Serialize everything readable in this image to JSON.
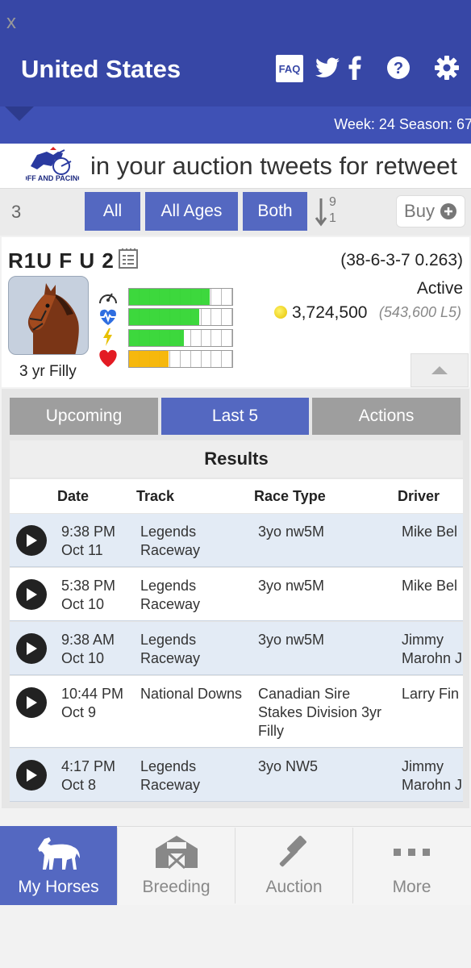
{
  "header": {
    "title": "United States",
    "faq_label": "FAQ",
    "week_season": "Week: 24  Season: 67"
  },
  "ticker": {
    "close": "x",
    "text": "in your auction tweets for retweet"
  },
  "filters": {
    "count": "3",
    "all": "All",
    "all_ages": "All Ages",
    "both": "Both",
    "sort_top": "9",
    "sort_bottom": "1",
    "buy": "Buy"
  },
  "horse": {
    "name": "R1U F U 2",
    "record": "(38-6-3-7 0.263)",
    "status": "Active",
    "earnings": "3,724,500",
    "last5": "(543,600 L5)",
    "age": "3 yr Filly",
    "stats": [
      {
        "icon": "speedometer-icon",
        "level": 0.78,
        "color": "#33d633"
      },
      {
        "icon": "heart-pulse-icon",
        "level": 0.68,
        "color": "#33d633"
      },
      {
        "icon": "lightning-icon",
        "level": 0.53,
        "color": "#33d633"
      },
      {
        "icon": "heart-icon",
        "level": 0.38,
        "color": "#f5b400"
      }
    ]
  },
  "tabs": [
    "Upcoming",
    "Last 5",
    "Actions"
  ],
  "results": {
    "title": "Results",
    "headers": [
      "Date",
      "Track",
      "Race Type",
      "Driver"
    ],
    "rows": [
      {
        "time": "9:38 PM",
        "date": "Oct 11",
        "track1": "Legends",
        "track2": "Raceway",
        "type1": "3yo nw5M",
        "type2": "",
        "type3": "",
        "driver1": "Mike Bel",
        "driver2": ""
      },
      {
        "time": "5:38 PM",
        "date": "Oct 10",
        "track1": "Legends",
        "track2": "Raceway",
        "type1": "3yo nw5M",
        "type2": "",
        "type3": "",
        "driver1": "Mike Bel",
        "driver2": ""
      },
      {
        "time": "9:38 AM",
        "date": "Oct 10",
        "track1": "Legends",
        "track2": "Raceway",
        "type1": "3yo nw5M",
        "type2": "",
        "type3": "",
        "driver1": "Jimmy",
        "driver2": "Marohn J"
      },
      {
        "time": "10:44 PM",
        "date": "Oct 9",
        "track1": "National Downs",
        "track2": "",
        "type1": "Canadian Sire",
        "type2": "Stakes Division 3yr",
        "type3": "Filly",
        "driver1": "Larry Fin",
        "driver2": ""
      },
      {
        "time": "4:17 PM",
        "date": "Oct 8",
        "track1": "Legends",
        "track2": "Raceway",
        "type1": "3yo NW5",
        "type2": "",
        "type3": "",
        "driver1": "Jimmy",
        "driver2": "Marohn J"
      }
    ]
  },
  "nav": [
    "My Horses",
    "Breeding",
    "Auction",
    "More"
  ],
  "colors": {
    "header": "#3747a6",
    "accent": "#5468c1",
    "tab_inactive": "#9e9e9e"
  }
}
